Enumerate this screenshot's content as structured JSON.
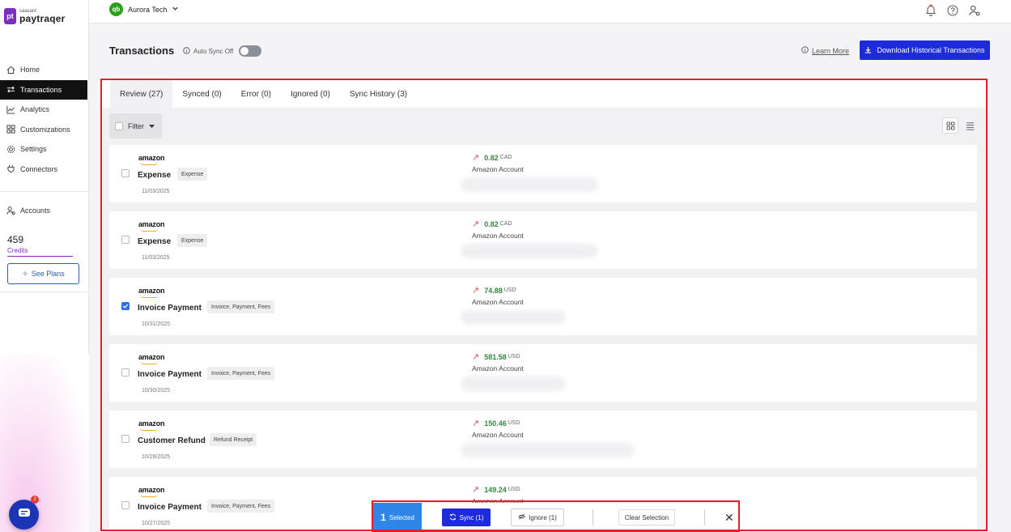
{
  "brand": {
    "small": "saasant",
    "name": "paytraqer",
    "mark": "pt"
  },
  "sidebar": {
    "items": [
      {
        "label": "Home",
        "icon": "home-icon"
      },
      {
        "label": "Transactions",
        "icon": "arrows-icon"
      },
      {
        "label": "Analytics",
        "icon": "chart-icon"
      },
      {
        "label": "Customizations",
        "icon": "grid-icon"
      },
      {
        "label": "Settings",
        "icon": "gear-icon"
      },
      {
        "label": "Connectors",
        "icon": "plug-icon"
      }
    ],
    "accounts_label": "Accounts",
    "credits_value": "459",
    "credits_label": "Credits",
    "see_plans_label": "See Plans",
    "chat_badge": "2"
  },
  "topbar": {
    "qb_mark": "qb",
    "company": "Aurora Tech"
  },
  "header": {
    "title": "Transactions",
    "auto_sync_label": "Auto Sync Off",
    "learn_more": "Learn More",
    "download_label": "Download Historical Transactions"
  },
  "tabs": [
    {
      "label": "Review (27)"
    },
    {
      "label": "Synced (0)"
    },
    {
      "label": "Error (0)"
    },
    {
      "label": "Ignored (0)"
    },
    {
      "label": "Sync History (3)"
    }
  ],
  "filter_label": "Filter",
  "rows": [
    {
      "vendor": "amazon",
      "type": "Expense",
      "tag": "Expense",
      "date": "11/03/2025",
      "amount": "0.82",
      "currency": "CAD",
      "account": "Amazon Account",
      "checked": false
    },
    {
      "vendor": "amazon",
      "type": "Expense",
      "tag": "Expense",
      "date": "11/03/2025",
      "amount": "0.82",
      "currency": "CAD",
      "account": "Amazon Account",
      "checked": false
    },
    {
      "vendor": "amazon",
      "type": "Invoice Payment",
      "tag": "Invoice, Payment, Fees",
      "date": "10/31/2025",
      "amount": "74.88",
      "currency": "USD",
      "account": "Amazon Account",
      "checked": true
    },
    {
      "vendor": "amazon",
      "type": "Invoice Payment",
      "tag": "Invoice, Payment, Fees",
      "date": "10/30/2025",
      "amount": "581.58",
      "currency": "USD",
      "account": "Amazon Account",
      "checked": false
    },
    {
      "vendor": "amazon",
      "type": "Customer Refund",
      "tag": "Refund Receipt",
      "date": "10/29/2025",
      "amount": "150.46",
      "currency": "USD",
      "account": "Amazon Account",
      "checked": false
    },
    {
      "vendor": "amazon",
      "type": "Invoice Payment",
      "tag": "Invoice, Payment, Fees",
      "date": "10/27/2025",
      "amount": "149.24",
      "currency": "USD",
      "account": "Amazon Account",
      "checked": false
    }
  ],
  "selection_bar": {
    "count": "1",
    "selected_label": "Selected",
    "sync_label": "Sync (1)",
    "ignore_label": "Ignore (1)",
    "clear_label": "Clear Selection"
  },
  "colors": {
    "accent": "#1d2bd8",
    "brand": "#7b2fbe",
    "highlight": "#e0202a",
    "amount": "#2e8b3d"
  }
}
